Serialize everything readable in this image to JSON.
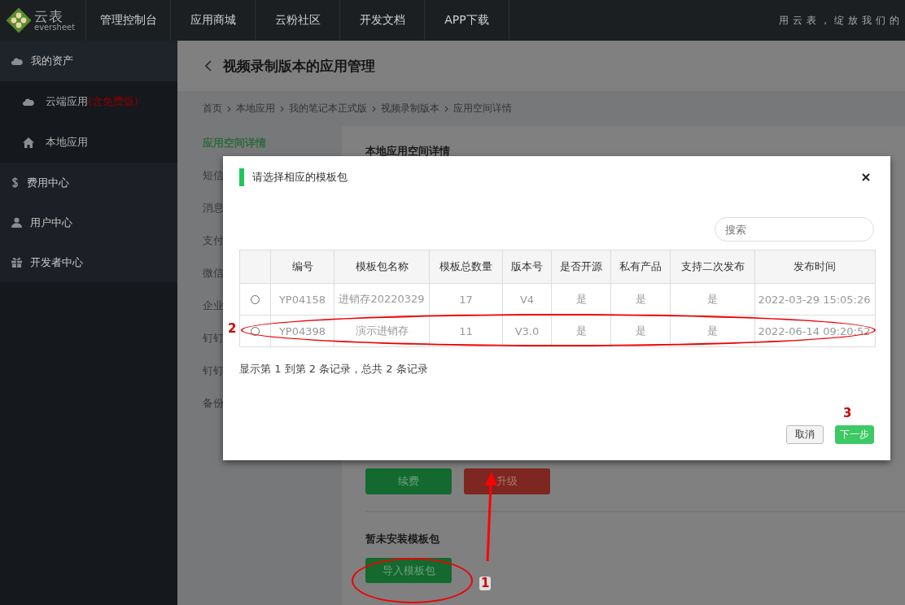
{
  "top_nav": {
    "logo_text": "云表",
    "logo_subtext": "eversheet",
    "items": [
      {
        "label": "管理控制台"
      },
      {
        "label": "应用商城"
      },
      {
        "label": "云粉社区"
      },
      {
        "label": "开发文档"
      },
      {
        "label": "APP下载"
      }
    ],
    "slogan": "用云表，绽放我们的"
  },
  "sidebar": {
    "items": [
      {
        "label": "我的资产",
        "expanded": true,
        "children": [
          {
            "label": "云端应用",
            "note": "(含免费版)"
          },
          {
            "label": "本地应用"
          }
        ]
      },
      {
        "label": "费用中心"
      },
      {
        "label": "用户中心"
      },
      {
        "label": "开发者中心"
      }
    ]
  },
  "page": {
    "title": "视频录制版本的应用管理",
    "breadcrumb": [
      "首页",
      "本地应用",
      "我的笔记本正式版",
      "视频录制版本",
      "应用空间详情"
    ],
    "submenu": [
      {
        "label": "应用空间详情",
        "selected": true
      },
      {
        "label": "短信",
        "selected": false
      },
      {
        "label": "消息",
        "selected": false
      },
      {
        "label": "支付",
        "selected": false
      },
      {
        "label": "微信",
        "selected": false
      },
      {
        "label": "企业",
        "selected": false
      },
      {
        "label": "钉钉",
        "selected": false
      },
      {
        "label": "钉钉",
        "selected": false
      },
      {
        "label": "备份",
        "selected": false
      }
    ],
    "panel_title": "本地应用空间详情",
    "actions": [
      {
        "label": "续费",
        "kind": "renew"
      },
      {
        "label": "升级",
        "kind": "upgrade"
      }
    ],
    "template_title": "暂未安装模板包",
    "import_button": "导入模板包"
  },
  "modal": {
    "title": "请选择相应的模板包",
    "search": {
      "placeholder": "搜索"
    },
    "columns": [
      "编号",
      "模板包名称",
      "模板总数量",
      "版本号",
      "是否开源",
      "私有产品",
      "支持二次发布",
      "发布时间"
    ],
    "rows": [
      {
        "selected": false,
        "cells": [
          "YP04158",
          "进销存20220329",
          "17",
          "V4",
          "是",
          "是",
          "是",
          "2022-03-29 15:05:26"
        ]
      },
      {
        "selected": false,
        "cells": [
          "YP04398",
          "演示进销存",
          "11",
          "V3.0",
          "是",
          "是",
          "是",
          "2022-06-14 09:20:52"
        ]
      }
    ],
    "footer": "显示第 1 到第 2 条记录，总共 2 条记录",
    "buttons": [
      {
        "label": "取消",
        "kind": "cancel"
      },
      {
        "label": "下一步",
        "kind": "primary"
      }
    ]
  },
  "annotations": [
    {
      "label": "1"
    },
    {
      "label": "2"
    },
    {
      "label": "3"
    }
  ]
}
